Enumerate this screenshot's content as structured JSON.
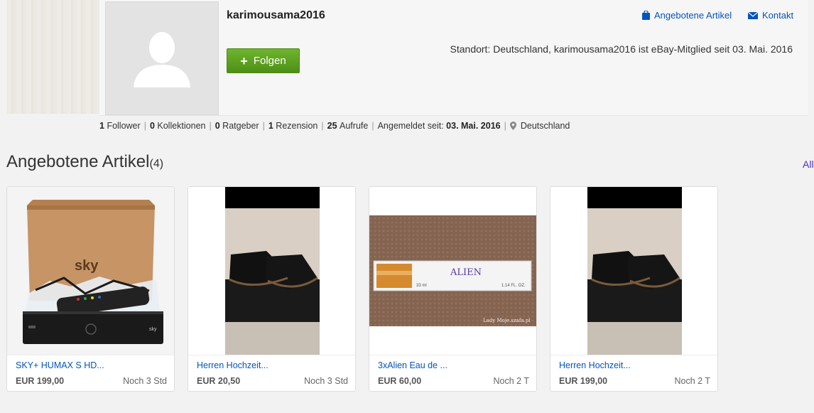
{
  "profile": {
    "username": "karimousama2016",
    "follow_label": "Folgen",
    "location_text": "Standort: Deutschland, karimousama2016 ist eBay-Mitglied seit 03. Mai. 2016",
    "links": {
      "offered_label": "Angebotene Artikel",
      "contact_label": "Kontakt"
    }
  },
  "stats": {
    "followers_count": "1",
    "followers_label": "Follower",
    "collections_count": "0",
    "collections_label": "Kollektionen",
    "guides_count": "0",
    "guides_label": "Ratgeber",
    "reviews_count": "1",
    "reviews_label": "Rezension",
    "views_count": "25",
    "views_label": "Aufrufe",
    "registered_label": "Angemeldet seit:",
    "registered_date": "03. Mai. 2016",
    "country": "Deutschland"
  },
  "section": {
    "title": "Angebotene Artikel",
    "count": "(4)",
    "all_label": "All"
  },
  "items": [
    {
      "title": "SKY+ HUMAX S HD...",
      "price": "EUR 199,00",
      "time": "Noch 3 Std"
    },
    {
      "title": "Herren Hochzeit...",
      "price": "EUR 20,50",
      "time": "Noch 3 Std"
    },
    {
      "title": "3xAlien Eau de ...",
      "price": "EUR 60,00",
      "time": "Noch 2 T"
    },
    {
      "title": "Herren Hochzeit...",
      "price": "EUR 199,00",
      "time": "Noch 2 T"
    }
  ],
  "item3_image": {
    "brand_text": "ALIEN",
    "volume_text": "33 ml",
    "oz_text": "1.14 FL. OZ.",
    "watermark": "Lady Moje.szafa.pl"
  },
  "colors": {
    "link": "#0654ba",
    "follow_green": "#5ea21d",
    "all_link": "#4b2dc4"
  }
}
